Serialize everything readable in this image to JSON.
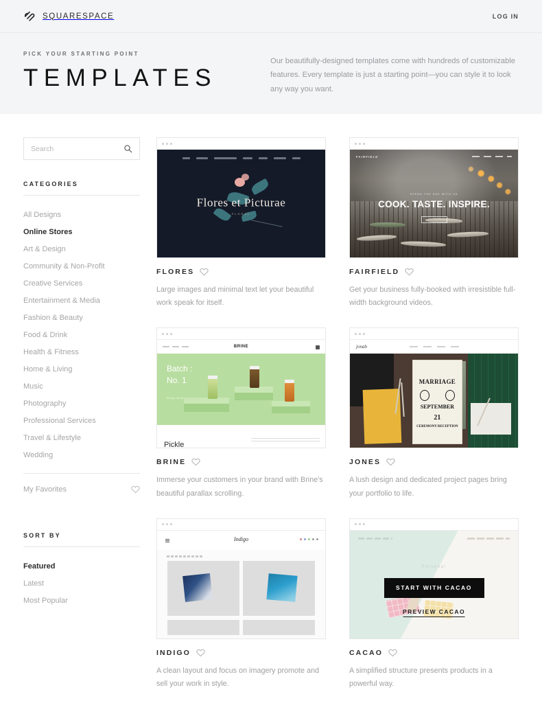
{
  "nav": {
    "brand": "SQUARESPACE",
    "brand_icon": "squarespace-logo-icon",
    "login": "LOG IN"
  },
  "hero": {
    "eyebrow": "PICK YOUR STARTING POINT",
    "title": "TEMPLATES",
    "description": "Our beautifully-designed templates come with hundreds of customizable features. Every template is just a starting point—you can style it to look any way you want."
  },
  "sidebar": {
    "search": {
      "placeholder": "Search",
      "value": "",
      "icon": "search-icon"
    },
    "categories_title": "CATEGORIES",
    "categories": [
      {
        "label": "All Designs",
        "active": false
      },
      {
        "label": "Online Stores",
        "active": true
      },
      {
        "label": "Art & Design",
        "active": false
      },
      {
        "label": "Community & Non-Profit",
        "active": false
      },
      {
        "label": "Creative Services",
        "active": false
      },
      {
        "label": "Entertainment & Media",
        "active": false
      },
      {
        "label": "Fashion & Beauty",
        "active": false
      },
      {
        "label": "Food & Drink",
        "active": false
      },
      {
        "label": "Health & Fitness",
        "active": false
      },
      {
        "label": "Home & Living",
        "active": false
      },
      {
        "label": "Music",
        "active": false
      },
      {
        "label": "Photography",
        "active": false
      },
      {
        "label": "Professional Services",
        "active": false
      },
      {
        "label": "Travel & Lifestyle",
        "active": false
      },
      {
        "label": "Wedding",
        "active": false
      }
    ],
    "favorites": {
      "label": "My Favorites",
      "icon": "heart-outline-icon"
    },
    "sort_title": "SORT BY",
    "sort_options": [
      {
        "label": "Featured",
        "active": true
      },
      {
        "label": "Latest",
        "active": false
      },
      {
        "label": "Most Popular",
        "active": false
      }
    ]
  },
  "templates": [
    {
      "name": "FLORES",
      "description": "Large images and minimal text let your beautiful work speak for itself.",
      "favorite_icon": "heart-outline-icon",
      "preview_text": {
        "title": "Flores et Picturae",
        "subtitle": "FLORAL"
      }
    },
    {
      "name": "FAIRFIELD",
      "description": "Get your business fully-booked with irresistible full-width background videos.",
      "favorite_icon": "heart-outline-icon",
      "preview_text": {
        "logo": "FAIRFIELD",
        "kicker": "SPEND THE DAY WITH US",
        "headline": "COOK. TASTE. INSPIRE."
      }
    },
    {
      "name": "BRINE",
      "description": "Immerse your customers in your brand with Brine's beautiful parallax scrolling.",
      "favorite_icon": "heart-outline-icon",
      "preview_text": {
        "logo": "BRINE",
        "batch": "Batch :",
        "batch_no": "No. 1",
        "cta": "Shop Now",
        "footer": "Pickle"
      }
    },
    {
      "name": "JONES",
      "description": "A lush design and dedicated project pages bring your portfolio to life.",
      "favorite_icon": "heart-outline-icon",
      "preview_text": {
        "logo": "jonah",
        "poster_a": "MARRIAGE",
        "poster_b": "SEPTEMBER",
        "poster_c": "21",
        "poster_d": "CEREMONY  RECEPTION"
      }
    },
    {
      "name": "INDIGO",
      "description": "A clean layout and focus on imagery promote and sell your work in style.",
      "favorite_icon": "heart-outline-icon",
      "preview_text": {
        "logo": "Indigo"
      }
    },
    {
      "name": "CACAO",
      "description": "A simplified structure presents products in a powerful way.",
      "favorite_icon": "heart-outline-icon",
      "hovered": true,
      "start_button": "START WITH CACAO",
      "preview_button": "PREVIEW CACAO",
      "preview_text": {
        "word": "Personal"
      }
    }
  ],
  "colors": {
    "page_bg": "#ffffff",
    "band_bg": "#f4f5f6",
    "text_dark": "#2c2c2c",
    "text_muted": "#a0a0a3",
    "border": "#e7e7e7",
    "cta_black": "#0d0d0d"
  }
}
